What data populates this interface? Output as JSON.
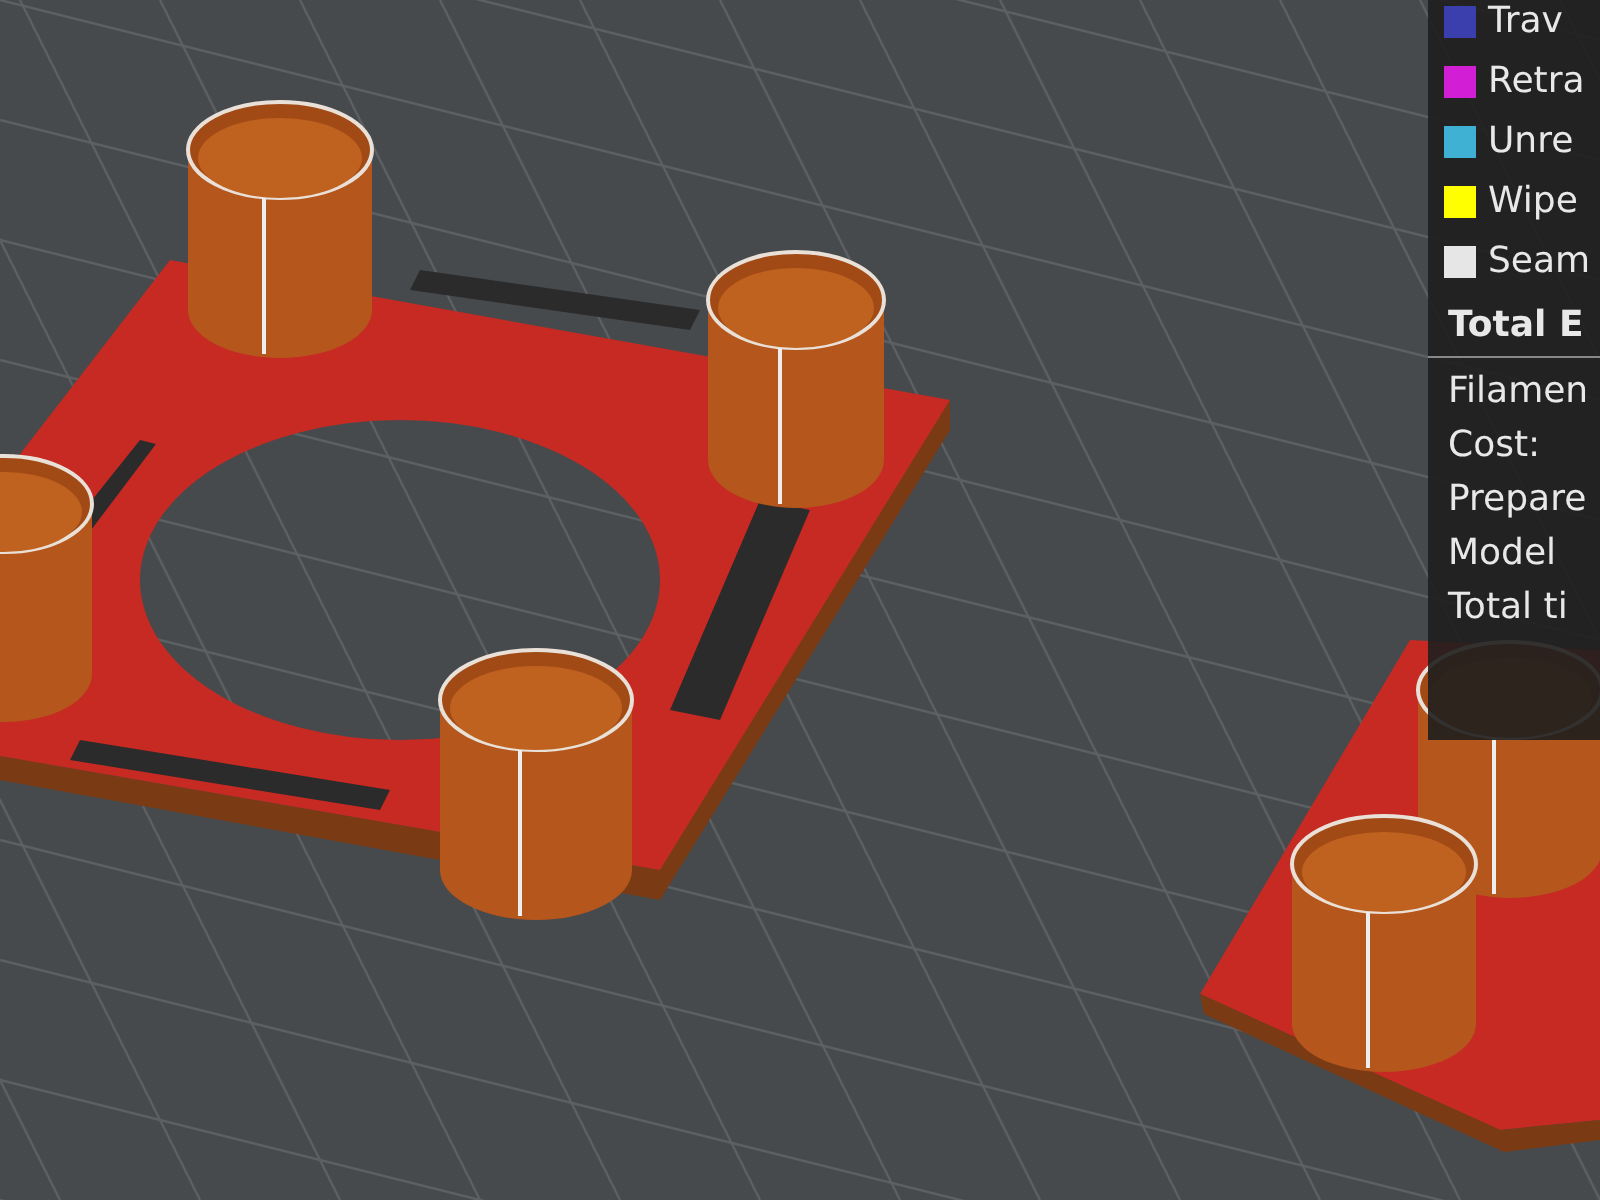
{
  "legend": {
    "items": [
      {
        "label": "Trav",
        "color": "#3b3fae"
      },
      {
        "label": "Retra",
        "color": "#d21fd6"
      },
      {
        "label": "Unre",
        "color": "#3fb2d4"
      },
      {
        "label": "Wipe",
        "color": "#ffff00"
      },
      {
        "label": "Seam",
        "color": "#e6e6e6"
      }
    ]
  },
  "estimates": {
    "title": "Total E",
    "rows": [
      "Filamen",
      "Cost:",
      "Prepare",
      "Model",
      "Total ti"
    ]
  }
}
